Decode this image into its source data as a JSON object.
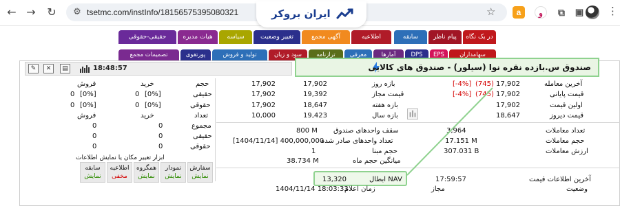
{
  "browser": {
    "url": "tsetmc.com/instInfo/18156575395080321",
    "logo_text": "ایران بروکر",
    "ext_a": "a",
    "ext_v": "و"
  },
  "tabs_top": [
    {
      "label": "در یک نگاه",
      "color": "#c0181c"
    },
    {
      "label": "پیام ناظر",
      "color": "#a11525"
    },
    {
      "label": "سابقه",
      "color": "#2d6fb8"
    },
    {
      "label": "اطلاعیه",
      "color": "#b01b28"
    },
    {
      "label": "آگهی مجمع",
      "color": "#f18a1f"
    },
    {
      "label": "تغییر وضعیت",
      "color": "#2b2f8c"
    },
    {
      "label": "سیاسه",
      "color": "#a9a600"
    },
    {
      "label": "هیات مدیره",
      "color": "#8a2a90"
    },
    {
      "label": "حقیقی-حقوقی",
      "color": "#6a2a9a"
    }
  ],
  "tabs_bottom": [
    {
      "label": "سهامداران",
      "color": "#c0181c"
    },
    {
      "label": "EPS",
      "color": "#d4145a"
    },
    {
      "label": "DPS",
      "color": "#2b2f8c"
    },
    {
      "label": "آمارها",
      "color": "#6b2a80"
    },
    {
      "label": "معرفی",
      "color": "#2d6fb8"
    },
    {
      "label": "ترازنامه",
      "color": "#5a6e1a"
    },
    {
      "label": "سود و زیان",
      "color": "#b01b28"
    },
    {
      "label": "تولید و فروش",
      "color": "#2d6fb8"
    },
    {
      "label": "پورتفوی",
      "color": "#2b2f8c"
    },
    {
      "label": "تصمیمات مجمع",
      "color": "#7a2a90"
    }
  ],
  "header": {
    "time": "18:48:57",
    "title": "صندوق س.بازده نقره نوا (سیلور) - صندوق های کالایی"
  },
  "prices": {
    "last_trade_label": "آخرین معامله",
    "last_trade_value": "17,902",
    "last_trade_change": "(745)",
    "last_trade_pct": "[-4%]",
    "close_label": "قیمت پایانی",
    "close_value": "17,902",
    "close_change": "(745)",
    "close_pct": "[-4%]",
    "open_label": "اولین قیمت",
    "open_value": "17,902",
    "yesterday_label": "قیمت دیروز",
    "yesterday_value": "18,647"
  },
  "ranges": {
    "day_label": "بازه روز",
    "day_low": "17,902",
    "day_high": "17,902",
    "allowed_label": "قیمت مجاز",
    "allowed_low": "17,902",
    "allowed_high": "19,392",
    "week_label": "بازه هفته",
    "week_low": "17,902",
    "week_high": "18,647",
    "year_label": "بازه سال",
    "year_low": "10,000",
    "year_high": "19,423"
  },
  "trades": {
    "count_label": "تعداد معاملات",
    "count_value": "3,964",
    "volume_label": "حجم معاملات",
    "volume_value": "17.151 M",
    "value_label": "ارزش معاملات",
    "value_value": "307.031 B"
  },
  "fund": {
    "cap_label": "سقف واحدهای صندوق",
    "cap_value": "800 M",
    "issued_label": "تعداد واحدهای صادر شده",
    "issued_value": "[1404/11/14] 400,000,000",
    "base_label": "حجم مبنا",
    "base_value": "1",
    "avg_label": "میانگین حجم ماه",
    "avg_value": "38.734 M"
  },
  "status": {
    "last_info_label": "آخرین اطلاعات قیمت",
    "last_info_value": "17:59:57",
    "state_label": "وضعیت",
    "state_value": "مجاز",
    "nav_label": "NAV ابطال",
    "nav_value": "13,320",
    "nav_time_label": "زمان اعلام",
    "nav_time_value": "1404/11/14 18:03:33"
  },
  "client": {
    "col_buy": "خرید",
    "col_sell": "فروش",
    "row_volume": "حجم",
    "row_count": "تعداد",
    "row_real": "حقیقی",
    "row_legal": "حقوقی",
    "vol_real_buy": "[0%]",
    "vol_real_buy_n": "0",
    "vol_real_sell": "[0%]",
    "vol_real_sell_n": "0",
    "vol_legal_buy": "[0%]",
    "vol_legal_buy_n": "0",
    "vol_legal_sell": "[0%]",
    "vol_legal_sell_n": "0",
    "row_total": "مجموع",
    "cnt_total_buy": "0",
    "cnt_total_sell": "0",
    "cnt_real_buy": "0",
    "cnt_real_sell": "0",
    "cnt_legal_buy": "0",
    "cnt_legal_sell": "0"
  },
  "tools": {
    "title": "ابزار تغییر مکان یا نمایش اطلاعات",
    "buttons": [
      {
        "label": "سفارش",
        "state": "نمایش",
        "muted": false
      },
      {
        "label": "نمودار",
        "state": "نمایش",
        "muted": false
      },
      {
        "label": "همگروه",
        "state": "نمایش",
        "muted": false
      },
      {
        "label": "اطلاعیه",
        "state": "مخفی",
        "muted": true
      },
      {
        "label": "سابقه",
        "state": "نمایش",
        "muted": false
      }
    ]
  },
  "colors": {
    "highlight_border": "#8fd28f",
    "highlight_fill": "#e9f5e4",
    "negative": "#d40000"
  }
}
